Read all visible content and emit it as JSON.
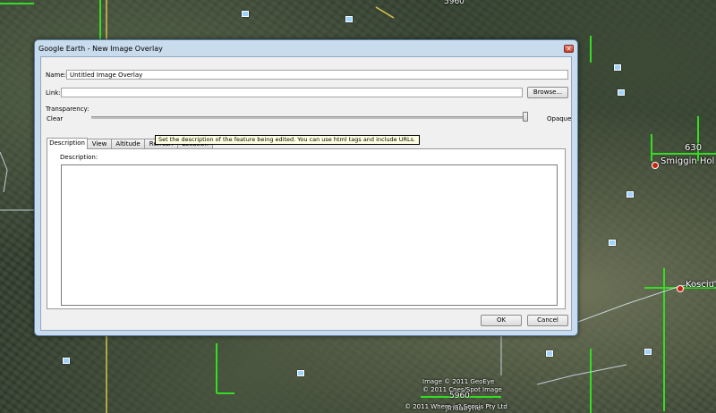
{
  "map": {
    "labels": {
      "top_elevation": "5960",
      "elevation_630": "630",
      "place_smiggin": "Smiggin Hol",
      "place_koscius": "Kosciu",
      "bottom_elevation": "5960",
      "bottom_cut": "Jindabyne"
    },
    "attribution": {
      "line1": "Image © 2011 GeoEye",
      "line2": "© 2011 Cnes/Spot Image",
      "line3": "© 2011 Where is? Sensis Pty Ltd"
    },
    "colors": {
      "grid_green": "#33dd22",
      "road_yellow": "#d8c24a",
      "border_white": "#d7e2ee"
    }
  },
  "dialog": {
    "title": "Google Earth - New Image Overlay",
    "close_glyph": "✕",
    "name_label": "Name:",
    "name_value": "Untitled Image Overlay",
    "link_label": "Link:",
    "link_value": "",
    "browse_label": "Browse...",
    "transparency_label": "Transparency:",
    "clear_label": "Clear",
    "opaque_label": "Opaque",
    "opacity_level": 1.0,
    "tabs": [
      {
        "label": "Description",
        "active": true
      },
      {
        "label": "View",
        "active": false
      },
      {
        "label": "Altitude",
        "active": false
      },
      {
        "label": "Refresh",
        "active": false
      },
      {
        "label": "Location",
        "active": false
      }
    ],
    "description_label": "Description:",
    "description_value": "",
    "tooltip": "Set the description of the feature being edited. You can use html tags and include URLs.",
    "ok_label": "OK",
    "cancel_label": "Cancel"
  }
}
